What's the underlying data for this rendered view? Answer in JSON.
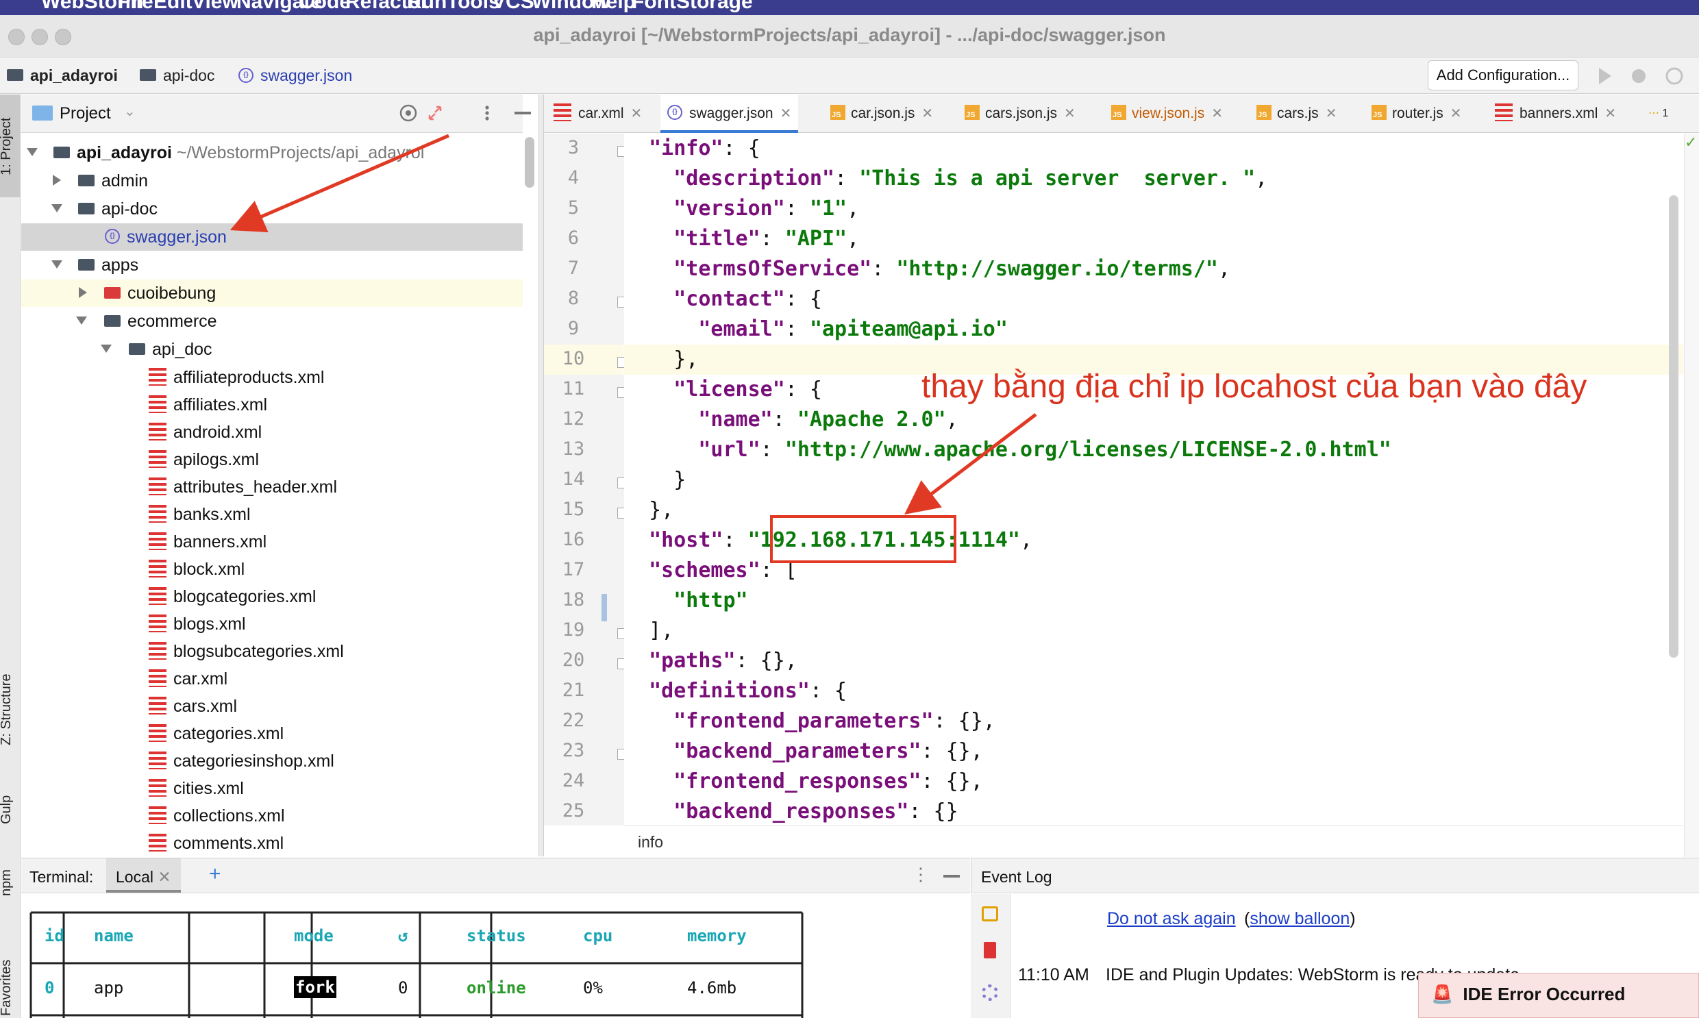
{
  "menubar": {
    "items": [
      "WebStorm",
      "File",
      "Edit",
      "View",
      "Navigate",
      "Code",
      "Refactor",
      "Run",
      "Tools",
      "VCS",
      "Window",
      "Help",
      "FontStorage"
    ]
  },
  "window": {
    "title": "api_adayroi [~/WebstormProjects/api_adayroi] - .../api-doc/swagger.json"
  },
  "navbar": {
    "breadcrumbs": [
      "api_adayroi",
      "api-doc",
      "swagger.json"
    ],
    "add_configuration": "Add Configuration..."
  },
  "side_tabs": {
    "project": "1: Project",
    "structure": "Z: Structure",
    "gulp": "Gulp",
    "npm": "npm",
    "favorites": "Favorites"
  },
  "project_panel": {
    "title": "Project",
    "root_name": "api_adayroi",
    "root_path": "~/WebstormProjects/api_adayroi",
    "items": [
      {
        "label": "admin",
        "type": "folder"
      },
      {
        "label": "api-doc",
        "type": "folder"
      },
      {
        "label": "swagger.json",
        "type": "json"
      },
      {
        "label": "apps",
        "type": "folder"
      },
      {
        "label": "cuoibebung",
        "type": "folder"
      },
      {
        "label": "ecommerce",
        "type": "folder"
      },
      {
        "label": "api_doc",
        "type": "folder"
      },
      {
        "label": "affiliateproducts.xml",
        "type": "xml"
      },
      {
        "label": "affiliates.xml",
        "type": "xml"
      },
      {
        "label": "android.xml",
        "type": "xml"
      },
      {
        "label": "apilogs.xml",
        "type": "xml"
      },
      {
        "label": "attributes_header.xml",
        "type": "xml"
      },
      {
        "label": "banks.xml",
        "type": "xml"
      },
      {
        "label": "banners.xml",
        "type": "xml"
      },
      {
        "label": "block.xml",
        "type": "xml"
      },
      {
        "label": "blogcategories.xml",
        "type": "xml"
      },
      {
        "label": "blogs.xml",
        "type": "xml"
      },
      {
        "label": "blogsubcategories.xml",
        "type": "xml"
      },
      {
        "label": "car.xml",
        "type": "xml"
      },
      {
        "label": "cars.xml",
        "type": "xml"
      },
      {
        "label": "categories.xml",
        "type": "xml"
      },
      {
        "label": "categoriesinshop.xml",
        "type": "xml"
      },
      {
        "label": "cities.xml",
        "type": "xml"
      },
      {
        "label": "collections.xml",
        "type": "xml"
      },
      {
        "label": "comments.xml",
        "type": "xml"
      }
    ]
  },
  "tabs": [
    "car.xml",
    "swagger.json",
    "car.json.js",
    "cars.json.js",
    "view.json.js",
    "cars.js",
    "router.js",
    "banners.xml"
  ],
  "tab_overflow": "1",
  "editor": {
    "line_numbers": [
      "3",
      "4",
      "5",
      "6",
      "7",
      "8",
      "9",
      "10",
      "11",
      "12",
      "13",
      "14",
      "15",
      "16",
      "17",
      "18",
      "19",
      "20",
      "21",
      "22",
      "23",
      "24",
      "25"
    ],
    "code": {
      "l3_key": "\"info\"",
      "l4_key": "\"description\"",
      "l4_val": "\"This is a api server  server. \"",
      "l5_key": "\"version\"",
      "l5_val": "\"1\"",
      "l6_key": "\"title\"",
      "l6_val": "\"API\"",
      "l7_key": "\"termsOfService\"",
      "l7_val": "\"http://swagger.io/terms/\"",
      "l8_key": "\"contact\"",
      "l9_key": "\"email\"",
      "l9_val": "\"apiteam@api.io\"",
      "l11_key": "\"license\"",
      "l12_key": "\"name\"",
      "l12_val": "\"Apache 2.0\"",
      "l13_key": "\"url\"",
      "l13_val": "\"http://www.apache.org/licenses/LICENSE-2.0.html\"",
      "l16_key": "\"host\"",
      "l16_val": "\"192.168.171.145:1114\"",
      "l17_key": "\"schemes\"",
      "l18_val": "\"http\"",
      "l20_key": "\"paths\"",
      "l21_key": "\"definitions\"",
      "l22_key": "\"frontend_parameters\"",
      "l23_key": "\"backend_parameters\"",
      "l24_key": "\"frontend_responses\"",
      "l25_key": "\"backend_responses\""
    },
    "breadcrumb": "info"
  },
  "annotation": "thay bằng địa chỉ ip locahost của bạn vào đây",
  "terminal": {
    "label": "Terminal:",
    "tab": "Local",
    "plus": "+",
    "columns": [
      "id",
      "name",
      "mode",
      "↺",
      "status",
      "cpu",
      "memory"
    ],
    "row": [
      "0",
      "app",
      "fork",
      "0",
      "online",
      "0%",
      "4.6mb"
    ]
  },
  "event_log": {
    "title": "Event Log",
    "link1": "Do not ask again",
    "link2": "show balloon",
    "entry_time": "11:10 AM",
    "entry_text": "IDE and Plugin Updates: WebStorm is ready to update."
  },
  "toast": {
    "text": "IDE Error Occurred"
  },
  "colors": {
    "keyword": "#7a0f7a",
    "string": "#0b7a0b",
    "annotation": "#d9331e",
    "menubar": "#3a3c8e",
    "link": "#1a3cc9"
  }
}
